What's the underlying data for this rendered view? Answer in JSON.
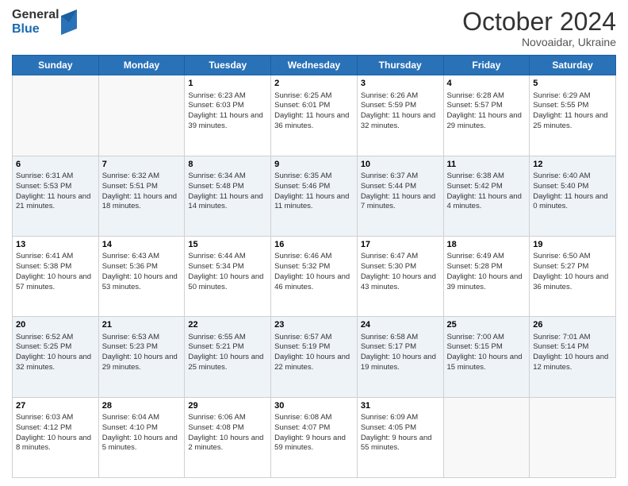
{
  "header": {
    "logo_general": "General",
    "logo_blue": "Blue",
    "month_title": "October 2024",
    "subtitle": "Novoaidar, Ukraine"
  },
  "weekdays": [
    "Sunday",
    "Monday",
    "Tuesday",
    "Wednesday",
    "Thursday",
    "Friday",
    "Saturday"
  ],
  "weeks": [
    [
      {
        "day": "",
        "sunrise": "",
        "sunset": "",
        "daylight": ""
      },
      {
        "day": "",
        "sunrise": "",
        "sunset": "",
        "daylight": ""
      },
      {
        "day": "1",
        "sunrise": "Sunrise: 6:23 AM",
        "sunset": "Sunset: 6:03 PM",
        "daylight": "Daylight: 11 hours and 39 minutes."
      },
      {
        "day": "2",
        "sunrise": "Sunrise: 6:25 AM",
        "sunset": "Sunset: 6:01 PM",
        "daylight": "Daylight: 11 hours and 36 minutes."
      },
      {
        "day": "3",
        "sunrise": "Sunrise: 6:26 AM",
        "sunset": "Sunset: 5:59 PM",
        "daylight": "Daylight: 11 hours and 32 minutes."
      },
      {
        "day": "4",
        "sunrise": "Sunrise: 6:28 AM",
        "sunset": "Sunset: 5:57 PM",
        "daylight": "Daylight: 11 hours and 29 minutes."
      },
      {
        "day": "5",
        "sunrise": "Sunrise: 6:29 AM",
        "sunset": "Sunset: 5:55 PM",
        "daylight": "Daylight: 11 hours and 25 minutes."
      }
    ],
    [
      {
        "day": "6",
        "sunrise": "Sunrise: 6:31 AM",
        "sunset": "Sunset: 5:53 PM",
        "daylight": "Daylight: 11 hours and 21 minutes."
      },
      {
        "day": "7",
        "sunrise": "Sunrise: 6:32 AM",
        "sunset": "Sunset: 5:51 PM",
        "daylight": "Daylight: 11 hours and 18 minutes."
      },
      {
        "day": "8",
        "sunrise": "Sunrise: 6:34 AM",
        "sunset": "Sunset: 5:48 PM",
        "daylight": "Daylight: 11 hours and 14 minutes."
      },
      {
        "day": "9",
        "sunrise": "Sunrise: 6:35 AM",
        "sunset": "Sunset: 5:46 PM",
        "daylight": "Daylight: 11 hours and 11 minutes."
      },
      {
        "day": "10",
        "sunrise": "Sunrise: 6:37 AM",
        "sunset": "Sunset: 5:44 PM",
        "daylight": "Daylight: 11 hours and 7 minutes."
      },
      {
        "day": "11",
        "sunrise": "Sunrise: 6:38 AM",
        "sunset": "Sunset: 5:42 PM",
        "daylight": "Daylight: 11 hours and 4 minutes."
      },
      {
        "day": "12",
        "sunrise": "Sunrise: 6:40 AM",
        "sunset": "Sunset: 5:40 PM",
        "daylight": "Daylight: 11 hours and 0 minutes."
      }
    ],
    [
      {
        "day": "13",
        "sunrise": "Sunrise: 6:41 AM",
        "sunset": "Sunset: 5:38 PM",
        "daylight": "Daylight: 10 hours and 57 minutes."
      },
      {
        "day": "14",
        "sunrise": "Sunrise: 6:43 AM",
        "sunset": "Sunset: 5:36 PM",
        "daylight": "Daylight: 10 hours and 53 minutes."
      },
      {
        "day": "15",
        "sunrise": "Sunrise: 6:44 AM",
        "sunset": "Sunset: 5:34 PM",
        "daylight": "Daylight: 10 hours and 50 minutes."
      },
      {
        "day": "16",
        "sunrise": "Sunrise: 6:46 AM",
        "sunset": "Sunset: 5:32 PM",
        "daylight": "Daylight: 10 hours and 46 minutes."
      },
      {
        "day": "17",
        "sunrise": "Sunrise: 6:47 AM",
        "sunset": "Sunset: 5:30 PM",
        "daylight": "Daylight: 10 hours and 43 minutes."
      },
      {
        "day": "18",
        "sunrise": "Sunrise: 6:49 AM",
        "sunset": "Sunset: 5:28 PM",
        "daylight": "Daylight: 10 hours and 39 minutes."
      },
      {
        "day": "19",
        "sunrise": "Sunrise: 6:50 AM",
        "sunset": "Sunset: 5:27 PM",
        "daylight": "Daylight: 10 hours and 36 minutes."
      }
    ],
    [
      {
        "day": "20",
        "sunrise": "Sunrise: 6:52 AM",
        "sunset": "Sunset: 5:25 PM",
        "daylight": "Daylight: 10 hours and 32 minutes."
      },
      {
        "day": "21",
        "sunrise": "Sunrise: 6:53 AM",
        "sunset": "Sunset: 5:23 PM",
        "daylight": "Daylight: 10 hours and 29 minutes."
      },
      {
        "day": "22",
        "sunrise": "Sunrise: 6:55 AM",
        "sunset": "Sunset: 5:21 PM",
        "daylight": "Daylight: 10 hours and 25 minutes."
      },
      {
        "day": "23",
        "sunrise": "Sunrise: 6:57 AM",
        "sunset": "Sunset: 5:19 PM",
        "daylight": "Daylight: 10 hours and 22 minutes."
      },
      {
        "day": "24",
        "sunrise": "Sunrise: 6:58 AM",
        "sunset": "Sunset: 5:17 PM",
        "daylight": "Daylight: 10 hours and 19 minutes."
      },
      {
        "day": "25",
        "sunrise": "Sunrise: 7:00 AM",
        "sunset": "Sunset: 5:15 PM",
        "daylight": "Daylight: 10 hours and 15 minutes."
      },
      {
        "day": "26",
        "sunrise": "Sunrise: 7:01 AM",
        "sunset": "Sunset: 5:14 PM",
        "daylight": "Daylight: 10 hours and 12 minutes."
      }
    ],
    [
      {
        "day": "27",
        "sunrise": "Sunrise: 6:03 AM",
        "sunset": "Sunset: 4:12 PM",
        "daylight": "Daylight: 10 hours and 8 minutes."
      },
      {
        "day": "28",
        "sunrise": "Sunrise: 6:04 AM",
        "sunset": "Sunset: 4:10 PM",
        "daylight": "Daylight: 10 hours and 5 minutes."
      },
      {
        "day": "29",
        "sunrise": "Sunrise: 6:06 AM",
        "sunset": "Sunset: 4:08 PM",
        "daylight": "Daylight: 10 hours and 2 minutes."
      },
      {
        "day": "30",
        "sunrise": "Sunrise: 6:08 AM",
        "sunset": "Sunset: 4:07 PM",
        "daylight": "Daylight: 9 hours and 59 minutes."
      },
      {
        "day": "31",
        "sunrise": "Sunrise: 6:09 AM",
        "sunset": "Sunset: 4:05 PM",
        "daylight": "Daylight: 9 hours and 55 minutes."
      },
      {
        "day": "",
        "sunrise": "",
        "sunset": "",
        "daylight": ""
      },
      {
        "day": "",
        "sunrise": "",
        "sunset": "",
        "daylight": ""
      }
    ]
  ]
}
